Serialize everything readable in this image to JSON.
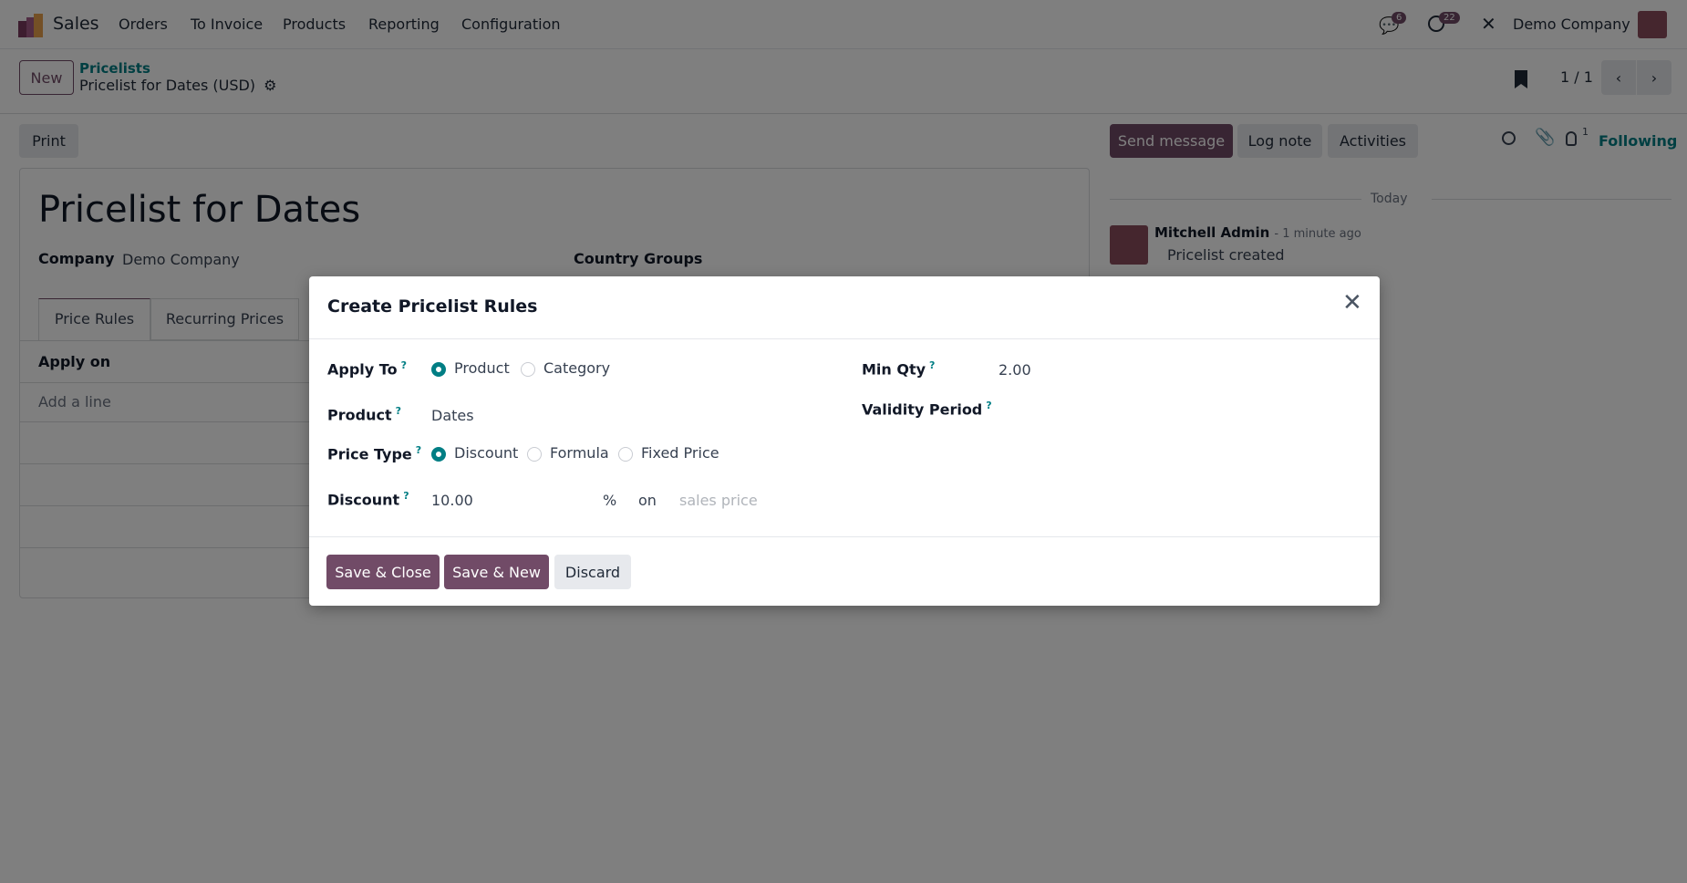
{
  "navbar": {
    "app": "Sales",
    "menu": [
      "Orders",
      "To Invoice",
      "Products",
      "Reporting",
      "Configuration"
    ],
    "messages_count": "6",
    "activities_count": "22",
    "company": "Demo Company"
  },
  "control_panel": {
    "new_label": "New",
    "breadcrumb_parent": "Pricelists",
    "breadcrumb_current": "Pricelist for Dates (USD)",
    "pager": "1 / 1"
  },
  "form": {
    "print_label": "Print",
    "title": "Pricelist for Dates",
    "company_label": "Company",
    "company_value": "Demo Company",
    "country_groups_label": "Country Groups",
    "tabs": [
      "Price Rules",
      "Recurring Prices"
    ],
    "table_header": "Apply on",
    "add_line": "Add a line"
  },
  "chatter": {
    "send_message": "Send message",
    "log_note": "Log note",
    "activities": "Activities",
    "followers_count": "1",
    "following": "Following",
    "date_sep": "Today",
    "author": "Mitchell Admin",
    "time": "- 1 minute ago",
    "message": "Pricelist created"
  },
  "modal": {
    "title": "Create Pricelist Rules",
    "apply_to_label": "Apply To",
    "apply_to_options": [
      "Product",
      "Category"
    ],
    "product_label": "Product",
    "product_value": "Dates",
    "price_type_label": "Price Type",
    "price_type_options": [
      "Discount",
      "Formula",
      "Fixed Price"
    ],
    "discount_label": "Discount",
    "discount_value": "10.00",
    "percent": "%",
    "on": "on",
    "base_placeholder": "sales price",
    "min_qty_label": "Min Qty",
    "min_qty_value": "2.00",
    "validity_label": "Validity Period",
    "help": "?",
    "save_close": "Save & Close",
    "save_new": "Save & New",
    "discard": "Discard"
  },
  "colors": {
    "primary": "#714b67",
    "accent": "#017e84"
  }
}
